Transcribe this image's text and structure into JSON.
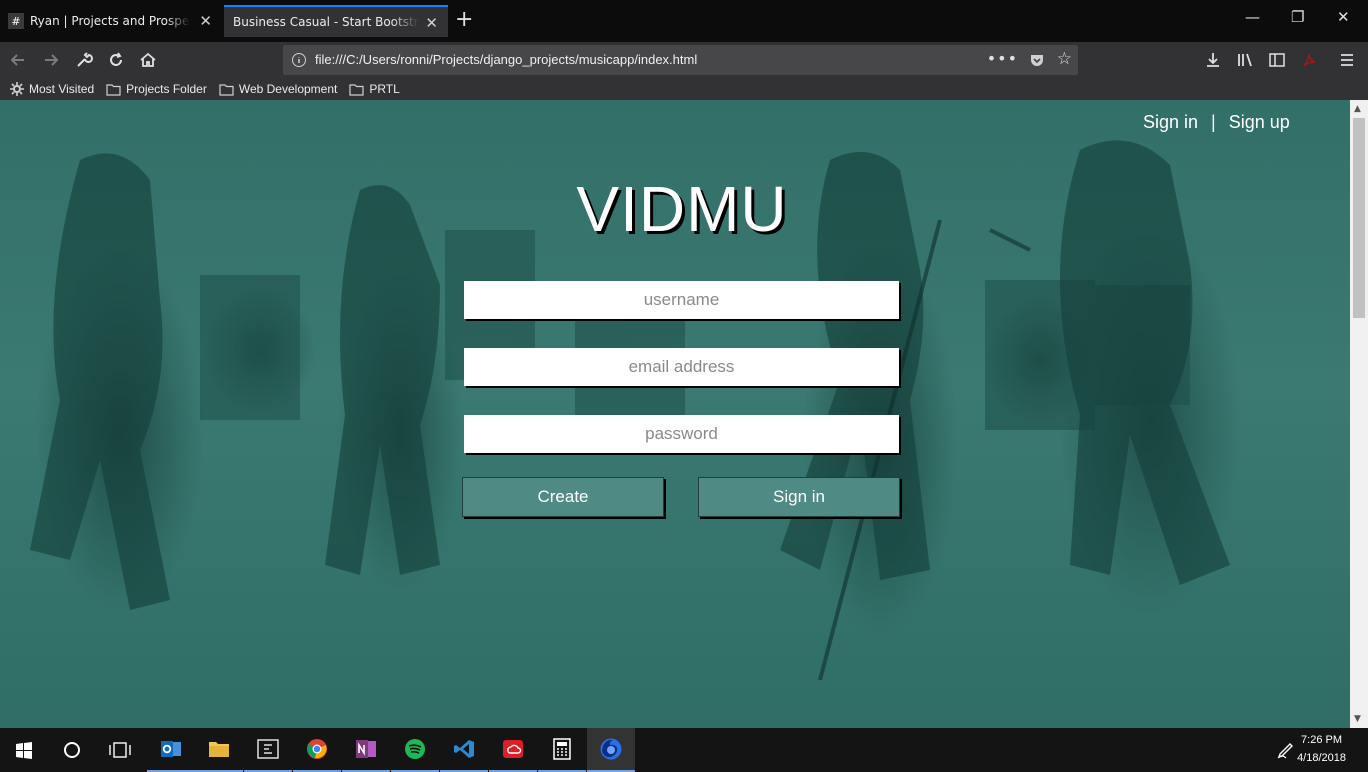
{
  "browser": {
    "tabs": [
      {
        "favicon": "#",
        "title": "Ryan | Projects and Prospects S"
      },
      {
        "favicon": "",
        "title": "Business Casual - Start Bootstrap Th"
      }
    ],
    "new_tab": "+",
    "url": "file:///C:/Users/ronni/Projects/django_projects/musicapp/index.html",
    "url_actions": "•••",
    "star": "☆",
    "window_controls": {
      "minimize": "—",
      "restore": "❐",
      "close": "✕"
    },
    "tab_close": "✕",
    "bookmarks": [
      {
        "label": "Most Visited",
        "icon": "gear-icon"
      },
      {
        "label": "Projects Folder",
        "icon": "folder-icon"
      },
      {
        "label": "Web Development",
        "icon": "folder-icon"
      },
      {
        "label": "PRTL",
        "icon": "folder-icon"
      }
    ]
  },
  "page": {
    "nav": {
      "sign_in": "Sign in",
      "separator": "|",
      "sign_up": "Sign up"
    },
    "brand": "VIDMU",
    "form": {
      "username_placeholder": "username",
      "email_placeholder": "email address",
      "password_placeholder": "password",
      "create_label": "Create",
      "signin_label": "Sign in"
    },
    "colors": {
      "overlay": "#326f68",
      "button": "#4f8a84"
    }
  },
  "taskbar": {
    "apps": [
      "windows-start-icon",
      "cortana-icon",
      "task-view-icon",
      "outlook-icon",
      "file-explorer-icon",
      "code-editor-icon",
      "chrome-icon",
      "onenote-icon",
      "spotify-icon",
      "vscode-icon",
      "creative-cloud-icon",
      "calculator-icon",
      "firefox-icon"
    ],
    "time": "7:26 PM",
    "date": "4/18/2018"
  }
}
